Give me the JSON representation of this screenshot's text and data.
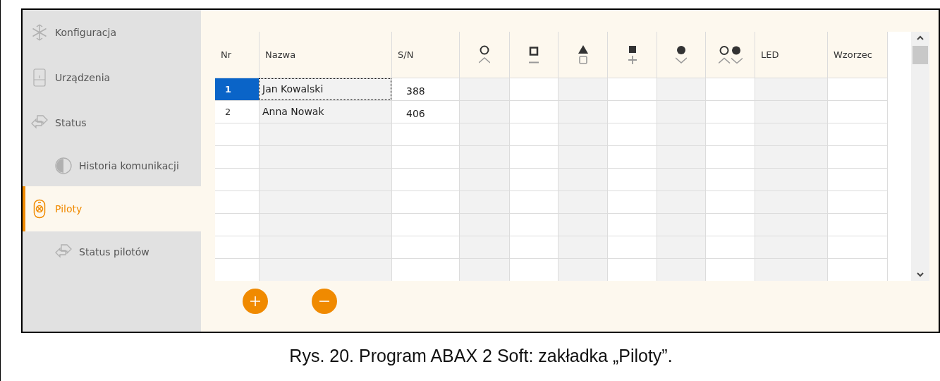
{
  "sidebar": {
    "items": [
      {
        "label": "Konfiguracja",
        "selected": false
      },
      {
        "label": "Urządzenia",
        "selected": false
      },
      {
        "label": "Status",
        "selected": false,
        "children": [
          {
            "label": "Historia komunikacji",
            "selected": false
          }
        ]
      },
      {
        "label": "Piloty",
        "selected": true,
        "children": [
          {
            "label": "Status pilotów",
            "selected": false
          }
        ]
      }
    ]
  },
  "table": {
    "columns": [
      {
        "kind": "text",
        "label": "Nr"
      },
      {
        "kind": "text",
        "label": "Nazwa"
      },
      {
        "kind": "text",
        "label": "S/N"
      },
      {
        "kind": "circle-up"
      },
      {
        "kind": "square-dash"
      },
      {
        "kind": "triangle-square"
      },
      {
        "kind": "square-plus"
      },
      {
        "kind": "dot-down"
      },
      {
        "kind": "circles-updown"
      },
      {
        "kind": "text",
        "label": "LED"
      },
      {
        "kind": "text",
        "label": "Wzorzec"
      }
    ],
    "rows": [
      {
        "nr": "1",
        "name": "Jan Kowalski",
        "sn": "388",
        "selected": true
      },
      {
        "nr": "2",
        "name": "Anna Nowak",
        "sn": "406",
        "selected": false
      }
    ]
  },
  "caption": "Rys. 20. Program ABAX 2 Soft: zakładka „Piloty”."
}
